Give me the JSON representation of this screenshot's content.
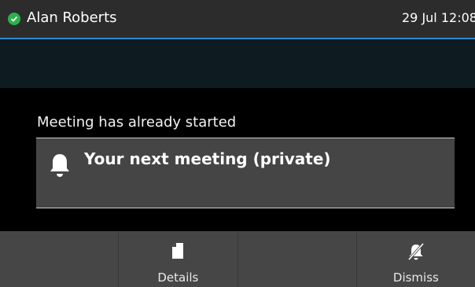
{
  "status_bar": {
    "user_name": "Alan Roberts",
    "datetime": "29 Jul 12:08",
    "presence": "available",
    "presence_color": "#2bb24c",
    "accent_color": "#2f88d0"
  },
  "notification": {
    "title": "Meeting has already started",
    "meeting": "Your next meeting (private)",
    "icon": "bell-icon"
  },
  "softkeys": [
    {
      "label": "",
      "icon": ""
    },
    {
      "label": "Details",
      "icon": "document-icon"
    },
    {
      "label": "",
      "icon": ""
    },
    {
      "label": "Dismiss",
      "icon": "bell-off-icon"
    }
  ]
}
